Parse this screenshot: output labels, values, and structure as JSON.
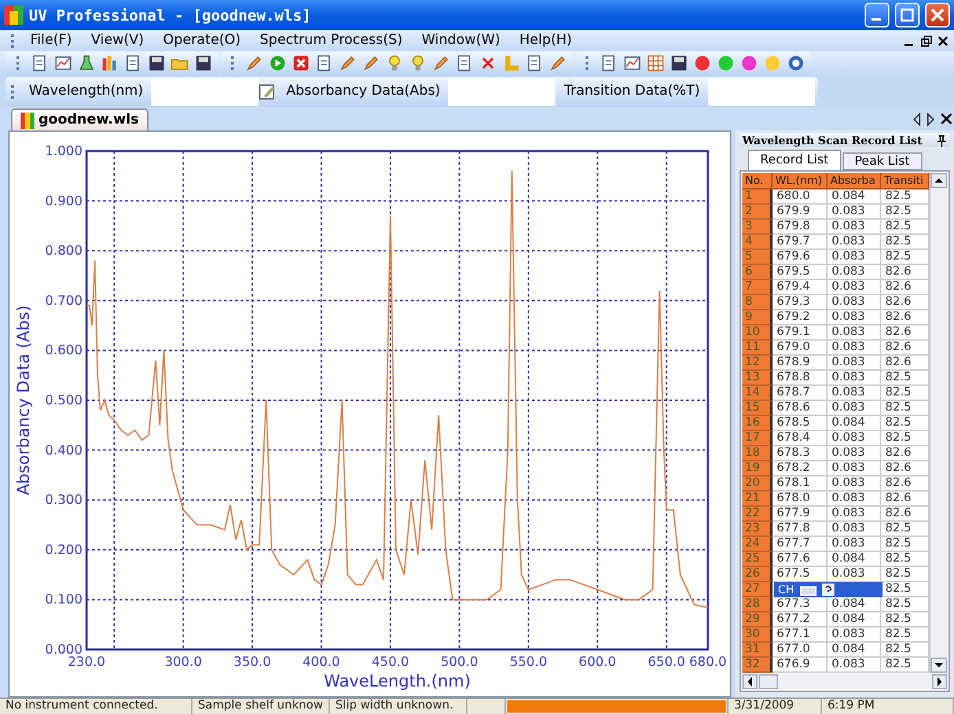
{
  "window": {
    "title": "UV Professional - [goodnew.wls]"
  },
  "menu": [
    {
      "label": "File(F)"
    },
    {
      "label": "View(V)"
    },
    {
      "label": "Operate(O)"
    },
    {
      "label": "Spectrum Process(S)"
    },
    {
      "label": "Window(W)"
    },
    {
      "label": "Help(H)"
    }
  ],
  "data_fields": [
    {
      "label": "Wavelength(nm)"
    },
    {
      "label": "Absorbancy Data(Abs)"
    },
    {
      "label": "Transition Data(%T)"
    }
  ],
  "document_tabs": [
    {
      "label": "goodnew.wls",
      "selected": true
    }
  ],
  "chart_panel": {
    "chart_data": {
      "type": "line",
      "grid": true,
      "xlabel": "WaveLength.(nm)",
      "ylabel": "Absorbancy Data (Abs)",
      "xlim": [
        230,
        680
      ],
      "ylim": [
        0,
        1
      ],
      "xticks": [
        {
          "value": 230,
          "label": "230.0"
        },
        {
          "value": 300,
          "label": "300.0"
        },
        {
          "value": 350,
          "label": "350.0"
        },
        {
          "value": 400,
          "label": "400.0"
        },
        {
          "value": 450,
          "label": "450.0"
        },
        {
          "value": 500,
          "label": "500.0"
        },
        {
          "value": 550,
          "label": "550.0"
        },
        {
          "value": 600,
          "label": "600.0"
        },
        {
          "value": 650,
          "label": "650.0"
        },
        {
          "value": 680,
          "label": "680.0"
        }
      ],
      "yticks": [
        {
          "value": 0,
          "label": "0.000"
        },
        {
          "value": 0.1,
          "label": "0.100"
        },
        {
          "value": 0.2,
          "label": "0.200"
        },
        {
          "value": 0.3,
          "label": "0.300"
        },
        {
          "value": 0.4,
          "label": "0.400"
        },
        {
          "value": 0.5,
          "label": "0.500"
        },
        {
          "value": 0.6,
          "label": "0.600"
        },
        {
          "value": 0.7,
          "label": "0.700"
        },
        {
          "value": 0.8,
          "label": "0.800"
        },
        {
          "value": 0.9,
          "label": "0.900"
        },
        {
          "value": 1,
          "label": "1.000"
        }
      ],
      "x": [
        230,
        232,
        234,
        236,
        238,
        240,
        243,
        246,
        250,
        255,
        260,
        265,
        270,
        275,
        280,
        283,
        286,
        289,
        292,
        296,
        300,
        310,
        320,
        330,
        334,
        338,
        342,
        346,
        350,
        355,
        360,
        364,
        370,
        380,
        390,
        395,
        400,
        405,
        410,
        415,
        419,
        425,
        430,
        440,
        445,
        450,
        454,
        460,
        465,
        470,
        475,
        480,
        485,
        490,
        495,
        500,
        520,
        530,
        535,
        538,
        542,
        545,
        550,
        560,
        570,
        580,
        590,
        600,
        610,
        620,
        630,
        640,
        645,
        648,
        650,
        655,
        660,
        670,
        680
      ],
      "series": [
        {
          "color": "#d9804a",
          "values": [
            0.69,
            0.69,
            0.65,
            0.78,
            0.55,
            0.48,
            0.5,
            0.47,
            0.46,
            0.44,
            0.43,
            0.44,
            0.42,
            0.43,
            0.58,
            0.45,
            0.6,
            0.42,
            0.36,
            0.32,
            0.28,
            0.25,
            0.25,
            0.24,
            0.29,
            0.22,
            0.26,
            0.2,
            0.21,
            0.21,
            0.5,
            0.2,
            0.17,
            0.15,
            0.18,
            0.14,
            0.13,
            0.17,
            0.25,
            0.5,
            0.15,
            0.13,
            0.13,
            0.18,
            0.14,
            0.87,
            0.2,
            0.15,
            0.3,
            0.19,
            0.38,
            0.24,
            0.47,
            0.2,
            0.1,
            0.1,
            0.1,
            0.12,
            0.4,
            0.96,
            0.3,
            0.15,
            0.12,
            0.13,
            0.14,
            0.14,
            0.13,
            0.12,
            0.11,
            0.1,
            0.1,
            0.12,
            0.72,
            0.4,
            0.28,
            0.28,
            0.15,
            0.09,
            0.084
          ]
        }
      ]
    }
  },
  "record_panel": {
    "title": "Wavelength Scan Record List",
    "tabs": [
      {
        "label": "Record List",
        "selected": true
      },
      {
        "label": "Peak List",
        "selected": false
      }
    ],
    "columns": [
      "No.",
      "WL.(nm)",
      "Absorba",
      "Transiti"
    ],
    "rows": [
      {
        "no": "1",
        "wl": "680.0",
        "abs": "0.084",
        "tr": "82.5"
      },
      {
        "no": "2",
        "wl": "679.9",
        "abs": "0.083",
        "tr": "82.5"
      },
      {
        "no": "3",
        "wl": "679.8",
        "abs": "0.083",
        "tr": "82.5"
      },
      {
        "no": "4",
        "wl": "679.7",
        "abs": "0.083",
        "tr": "82.5"
      },
      {
        "no": "5",
        "wl": "679.6",
        "abs": "0.083",
        "tr": "82.5"
      },
      {
        "no": "6",
        "wl": "679.5",
        "abs": "0.083",
        "tr": "82.6"
      },
      {
        "no": "7",
        "wl": "679.4",
        "abs": "0.083",
        "tr": "82.6"
      },
      {
        "no": "8",
        "wl": "679.3",
        "abs": "0.083",
        "tr": "82.6"
      },
      {
        "no": "9",
        "wl": "679.2",
        "abs": "0.083",
        "tr": "82.6"
      },
      {
        "no": "10",
        "wl": "679.1",
        "abs": "0.083",
        "tr": "82.6"
      },
      {
        "no": "11",
        "wl": "679.0",
        "abs": "0.083",
        "tr": "82.6"
      },
      {
        "no": "12",
        "wl": "678.9",
        "abs": "0.083",
        "tr": "82.6"
      },
      {
        "no": "13",
        "wl": "678.8",
        "abs": "0.083",
        "tr": "82.5"
      },
      {
        "no": "14",
        "wl": "678.7",
        "abs": "0.083",
        "tr": "82.5"
      },
      {
        "no": "15",
        "wl": "678.6",
        "abs": "0.083",
        "tr": "82.5"
      },
      {
        "no": "16",
        "wl": "678.5",
        "abs": "0.084",
        "tr": "82.5"
      },
      {
        "no": "17",
        "wl": "678.4",
        "abs": "0.083",
        "tr": "82.5"
      },
      {
        "no": "18",
        "wl": "678.3",
        "abs": "0.083",
        "tr": "82.6"
      },
      {
        "no": "19",
        "wl": "678.2",
        "abs": "0.083",
        "tr": "82.6"
      },
      {
        "no": "20",
        "wl": "678.1",
        "abs": "0.083",
        "tr": "82.6"
      },
      {
        "no": "21",
        "wl": "678.0",
        "abs": "0.083",
        "tr": "82.6"
      },
      {
        "no": "22",
        "wl": "677.9",
        "abs": "0.083",
        "tr": "82.6"
      },
      {
        "no": "23",
        "wl": "677.8",
        "abs": "0.083",
        "tr": "82.5"
      },
      {
        "no": "24",
        "wl": "677.7",
        "abs": "0.083",
        "tr": "82.5"
      },
      {
        "no": "25",
        "wl": "677.6",
        "abs": "0.084",
        "tr": "82.5"
      },
      {
        "no": "26",
        "wl": "677.5",
        "abs": "0.083",
        "tr": "82.5"
      },
      {
        "no": "27",
        "tr": "82.5"
      },
      {
        "no": "28",
        "wl": "677.3",
        "abs": "0.084",
        "tr": "82.5"
      },
      {
        "no": "29",
        "wl": "677.2",
        "abs": "0.084",
        "tr": "82.5"
      },
      {
        "no": "30",
        "wl": "677.1",
        "abs": "0.083",
        "tr": "82.5"
      },
      {
        "no": "31",
        "wl": "677.0",
        "abs": "0.084",
        "tr": "82.5"
      },
      {
        "no": "32",
        "wl": "676.9",
        "abs": "0.083",
        "tr": "82.5"
      }
    ]
  },
  "ime_bar": {
    "label": "CH"
  },
  "status_bar": {
    "fields": [
      "No instrument connected.",
      "Sample shelf unknow",
      "Slip width unknown."
    ],
    "progress": {
      "level": 1
    },
    "date": "3/31/2009",
    "time": "6:19 PM"
  }
}
